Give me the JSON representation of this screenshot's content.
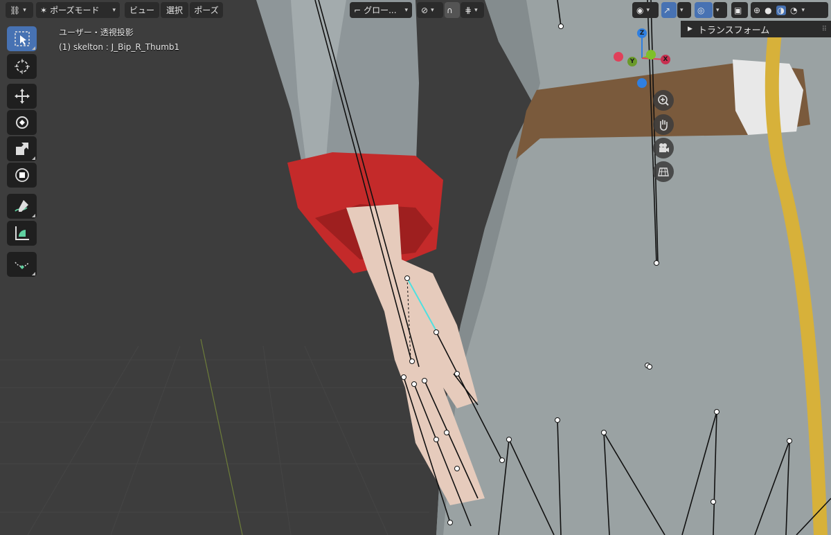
{
  "header": {
    "mode_label": "ポーズモード",
    "menu_view": "ビュー",
    "menu_select": "選択",
    "menu_pose": "ポーズ",
    "transform_orientation": "グロー..."
  },
  "overlay": {
    "view_name": "ユーザー・透視投影",
    "active_object": "(1) skelton : J_Bip_R_Thumb1"
  },
  "sidebar": {
    "panel_title": "トランスフォーム"
  },
  "gizmo": {
    "x_label": "X",
    "y_label": "Y",
    "z_label": "Z",
    "colors": {
      "x": "#e0405a",
      "y": "#7fc028",
      "z": "#2f7fe0"
    }
  },
  "toolbar": {
    "tools": [
      "select-box-icon",
      "cursor-icon",
      "move-icon",
      "rotate-icon",
      "scale-icon",
      "transform-icon",
      "annotate-icon",
      "measure-icon",
      "relax-pose-icon"
    ],
    "active_tool": "select-box-icon"
  },
  "nav_gizmo_icons": [
    "zoom-icon",
    "pan-hand-icon",
    "camera-icon",
    "ortho-grid-icon"
  ],
  "colors": {
    "accent": "#4772b3",
    "background": "#3d3d3d",
    "selected_bone": "#4ee0e0"
  }
}
